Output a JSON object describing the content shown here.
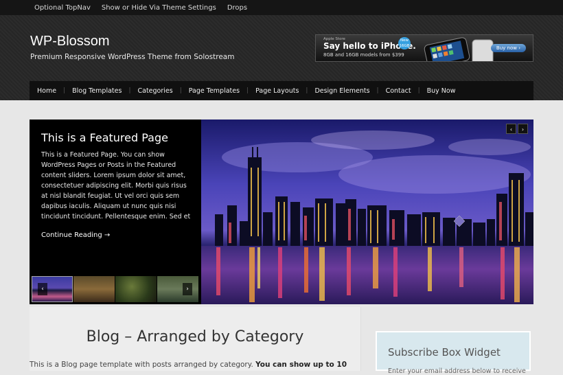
{
  "topnav": {
    "items": [
      "Optional TopNav",
      "Show or Hide Via Theme Settings",
      "Drops"
    ]
  },
  "header": {
    "title": "WP-Blossom",
    "description": "Premium Responsive WordPress Theme from Solostream",
    "ad": {
      "store_label": "Apple Store",
      "headline": "Say hello to iPhone.",
      "models": "8GB and 16GB models from $399",
      "badge_line1": "New",
      "badge_line2": "16GB",
      "buy_label": "Buy now ›"
    }
  },
  "mainnav": {
    "items": [
      "Home",
      "Blog Templates",
      "Categories",
      "Page Templates",
      "Page Layouts",
      "Design Elements",
      "Contact",
      "Buy Now"
    ]
  },
  "featured": {
    "title": "This is a Featured Page",
    "body": "This is a Featured Page. You can show WordPress Pages or Posts in the Featured content sliders. Lorem ipsum dolor sit amet, consectetuer adipiscing elit. Morbi quis risus at nisl blandit feugiat. Ut vel orci quis sem dapibus iaculis. Aliquam ut nunc quis nisi tincidunt tincidunt. Pellentesque enim. Sed et",
    "link": "Continue Reading →",
    "prev": "‹",
    "next": "›"
  },
  "content": {
    "title": "Blog – Arranged by Category",
    "intro_plain": "This is a Blog page template with posts arranged by category. ",
    "intro_bold": "You can show up to 10"
  },
  "sidebar": {
    "widget_title": "Subscribe Box Widget",
    "widget_text": "Enter your email address below to receive"
  },
  "colors": {
    "accent": "#36a0e0",
    "nav_bg": "#101010",
    "header_bg": "#2a2a2a"
  }
}
